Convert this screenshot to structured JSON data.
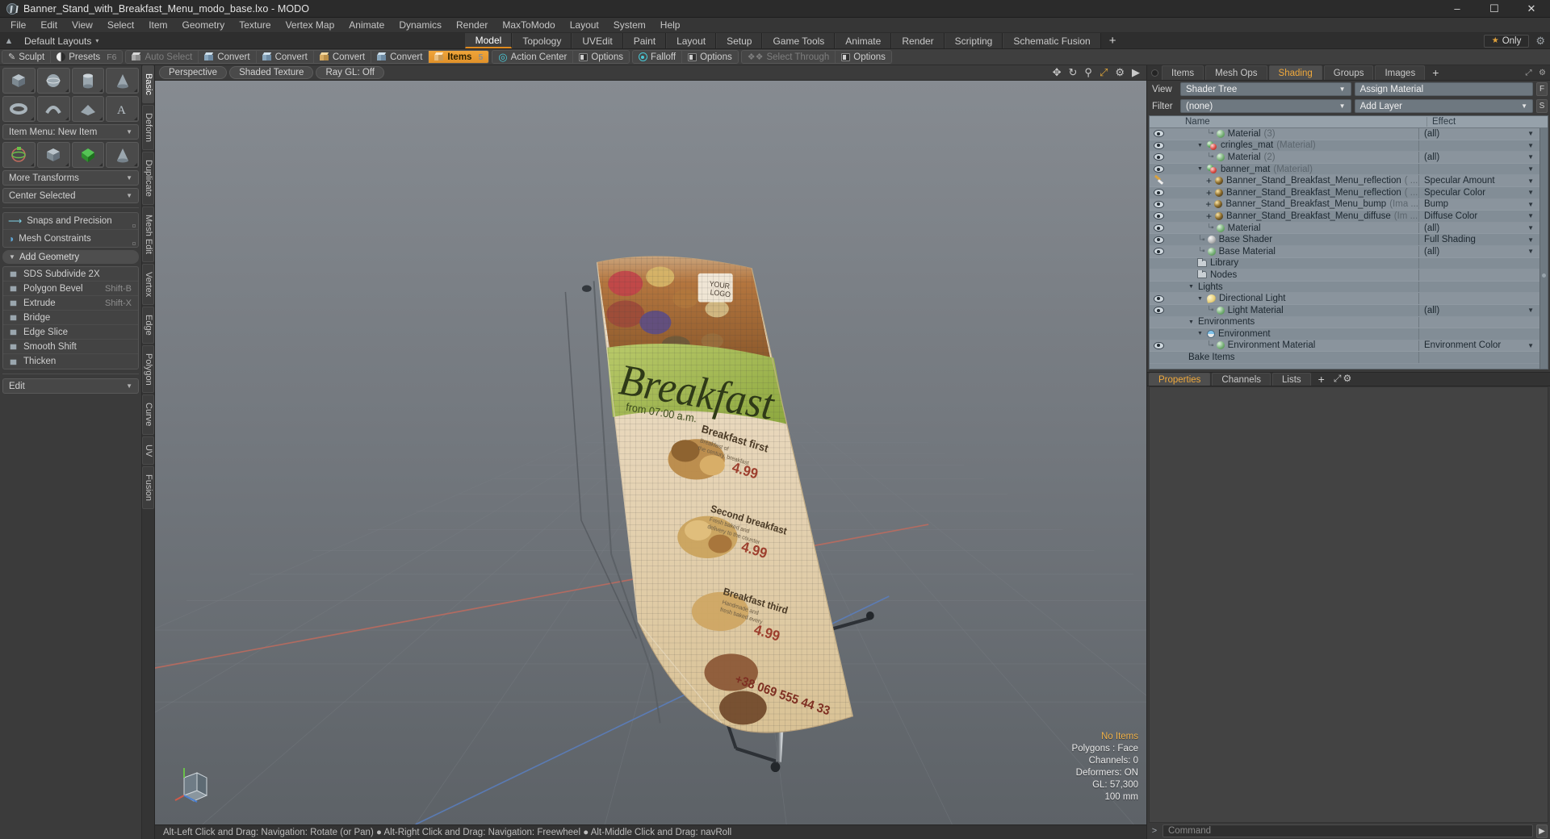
{
  "window": {
    "title": "Banner_Stand_with_Breakfast_Menu_modo_base.lxo - MODO",
    "minimize": "–",
    "maximize": "☐",
    "close": "✕"
  },
  "menubar": {
    "items": [
      "File",
      "Edit",
      "View",
      "Select",
      "Item",
      "Geometry",
      "Texture",
      "Vertex Map",
      "Animate",
      "Dynamics",
      "Render",
      "MaxToModo",
      "Layout",
      "System",
      "Help"
    ]
  },
  "layout_row": {
    "default_layouts": "Default Layouts",
    "caret": "▾",
    "tabs": [
      {
        "label": "Model",
        "active": true
      },
      {
        "label": "Topology",
        "active": false
      },
      {
        "label": "UVEdit",
        "active": false
      },
      {
        "label": "Paint",
        "active": false
      },
      {
        "label": "Layout",
        "active": false
      },
      {
        "label": "Setup",
        "active": false
      },
      {
        "label": "Game Tools",
        "active": false
      },
      {
        "label": "Animate",
        "active": false
      },
      {
        "label": "Render",
        "active": false
      },
      {
        "label": "Scripting",
        "active": false
      },
      {
        "label": "Schematic Fusion",
        "active": false
      }
    ],
    "add_tab": "+",
    "only_button": "Only",
    "only_star": "★"
  },
  "toolstrip": {
    "group1": [
      {
        "label": "Sculpt",
        "icon": "pen-icon",
        "state": "normal",
        "shortcut": ""
      },
      {
        "label": "Presets",
        "icon": "presets-icon",
        "state": "normal",
        "shortcut": "F6"
      }
    ],
    "group2": [
      {
        "label": "Auto Select",
        "icon": "cube-grey-icon",
        "state": "dim",
        "shortcut": ""
      },
      {
        "label": "Convert",
        "icon": "convert-cube-icon",
        "state": "normal",
        "shortcut": ""
      },
      {
        "label": "Convert",
        "icon": "convert-cube-icon",
        "state": "normal",
        "shortcut": ""
      },
      {
        "label": "Convert",
        "icon": "convert-cube-gold-icon",
        "state": "normal",
        "shortcut": ""
      },
      {
        "label": "Convert",
        "icon": "convert-cube-icon",
        "state": "normal",
        "shortcut": ""
      },
      {
        "label": "Items",
        "icon": "items-cube-icon",
        "state": "hot",
        "shortcut": "5"
      }
    ],
    "group3": [
      {
        "label": "Action Center",
        "icon": "action-center-icon",
        "state": "normal",
        "shortcut": ""
      },
      {
        "label": "Options",
        "icon": "options-icon",
        "state": "normal",
        "shortcut": ""
      }
    ],
    "group4": [
      {
        "label": "Falloff",
        "icon": "falloff-icon",
        "state": "normal",
        "shortcut": ""
      },
      {
        "label": "Options",
        "icon": "options-icon",
        "state": "normal",
        "shortcut": ""
      }
    ],
    "group5": [
      {
        "label": "Select Through",
        "icon": "select-through-icon",
        "state": "dim",
        "shortcut": ""
      },
      {
        "label": "Options",
        "icon": "options-icon",
        "state": "normal",
        "shortcut": ""
      }
    ]
  },
  "sidebar": {
    "shape_row_1": [
      "box-icon",
      "sphere-icon",
      "cylinder-icon",
      "cone-icon"
    ],
    "shape_row_2": [
      "torus-icon",
      "tube-icon",
      "plane-icon",
      "text-icon"
    ],
    "item_menu": "Item Menu: New Item",
    "transform_icons": [
      "transform-gizmo-icon",
      "mesh-plane-icon",
      "checker-mesh-icon",
      "cone-mesh-icon"
    ],
    "more_transforms": "More Transforms",
    "center_selected": "Center Selected",
    "snaps": {
      "label": "Snaps and Precision",
      "icon": "snap-arrow-icon"
    },
    "constraints": {
      "label": "Mesh Constraints",
      "icon": "constraint-icon"
    },
    "add_geometry_header": "Add Geometry",
    "geometry_tools": [
      {
        "label": "SDS Subdivide 2X",
        "shortcut": "",
        "icon": "subdivide-icon"
      },
      {
        "label": "Polygon Bevel",
        "shortcut": "Shift-B",
        "icon": "bevel-icon"
      },
      {
        "label": "Extrude",
        "shortcut": "Shift-X",
        "icon": "extrude-icon"
      },
      {
        "label": "Bridge",
        "shortcut": "",
        "icon": "bridge-icon"
      },
      {
        "label": "Edge Slice",
        "shortcut": "",
        "icon": "edge-slice-icon"
      },
      {
        "label": "Smooth Shift",
        "shortcut": "",
        "icon": "smooth-shift-icon"
      },
      {
        "label": "Thicken",
        "shortcut": "",
        "icon": "thicken-icon"
      }
    ],
    "edit_dropdown": "Edit",
    "vertical_tabs": [
      {
        "label": "Basic",
        "active": true
      },
      {
        "label": "Deform",
        "active": false
      },
      {
        "label": "Duplicate",
        "active": false
      },
      {
        "label": "Mesh Edit",
        "active": false
      },
      {
        "label": "Vertex",
        "active": false
      },
      {
        "label": "Edge",
        "active": false
      },
      {
        "label": "Polygon",
        "active": false
      },
      {
        "label": "Curve",
        "active": false
      },
      {
        "label": "UV",
        "active": false
      },
      {
        "label": "Fusion",
        "active": false
      }
    ]
  },
  "viewport": {
    "chips": [
      "Perspective",
      "Shaded Texture",
      "Ray GL: Off"
    ],
    "icons": [
      "move-icon",
      "rotate-icon",
      "zoom-icon",
      "fit-icon",
      "gear-icon",
      "play-arrow-icon"
    ],
    "hud": {
      "items": "No Items",
      "polygons": "Polygons : Face",
      "channels": "Channels: 0",
      "deformers": "Deformers: ON",
      "gl": "GL: 57,300",
      "scale": "100 mm"
    },
    "banner_text": {
      "logo": "YOUR LOGO",
      "title": "Breakfast",
      "subtitle": "from 07:00 a.m.",
      "items": [
        {
          "name": "Breakfast first",
          "desc": "Breakfast of\nthe century, breakfast is delicious",
          "price": "4.99"
        },
        {
          "name": "Second breakfast",
          "desc": "Fresh baked and\ndelivery to the counter",
          "price": "4.99"
        },
        {
          "name": "Breakfast third",
          "desc": "Handmade and\nfresh baked every morning",
          "price": "4.99"
        }
      ],
      "phone": "+38 069 555 44 33"
    }
  },
  "statusbar": {
    "text": "Alt-Left Click and Drag: Navigation: Rotate (or Pan)  ●  Alt-Right Click and Drag: Navigation: Freewheel  ●  Alt-Middle Click and Drag: navRoll"
  },
  "right_panel": {
    "tabs": [
      {
        "label": "Items",
        "active": false
      },
      {
        "label": "Mesh Ops",
        "active": false
      },
      {
        "label": "Shading",
        "active": true
      },
      {
        "label": "Groups",
        "active": false
      },
      {
        "label": "Images",
        "active": false
      },
      {
        "label": "+",
        "active": false
      }
    ],
    "view_label": "View",
    "view_value": "Shader Tree",
    "assign_material": "Assign Material",
    "assign_btn": "F",
    "filter_label": "Filter",
    "filter_value": "(none)",
    "add_layer": "Add Layer",
    "add_layer_btn": "S",
    "columns": {
      "name": "Name",
      "effect": "Effect"
    },
    "tree": [
      {
        "eye": "eye",
        "indent": 4,
        "connector": "end",
        "icon": "sphere-green",
        "name": "Material",
        "count": "(3)",
        "effect": "(all)",
        "caret": true
      },
      {
        "eye": "eye",
        "indent": 3,
        "connector": "tri",
        "icon": "material-dual",
        "name": "cringles_mat",
        "count": "(Material)",
        "effect": "",
        "caret": true
      },
      {
        "eye": "eye",
        "indent": 4,
        "connector": "end",
        "icon": "sphere-green",
        "name": "Material",
        "count": "(2)",
        "effect": "(all)",
        "caret": true
      },
      {
        "eye": "eye",
        "indent": 3,
        "connector": "tri",
        "icon": "material-dual",
        "name": "banner_mat",
        "count": "(Material)",
        "effect": "",
        "caret": true
      },
      {
        "eye": "brush",
        "indent": 4,
        "connector": "plus",
        "icon": "sphere-dark",
        "name": "Banner_Stand_Breakfast_Menu_reflection",
        "count": "( ...",
        "effect": "Specular Amount",
        "caret": true
      },
      {
        "eye": "eye",
        "indent": 4,
        "connector": "plus",
        "icon": "sphere-dark",
        "name": "Banner_Stand_Breakfast_Menu_reflection",
        "count": "( ...",
        "effect": "Specular Color",
        "caret": true
      },
      {
        "eye": "eye",
        "indent": 4,
        "connector": "plus",
        "icon": "sphere-dark",
        "name": "Banner_Stand_Breakfast_Menu_bump",
        "count": "(Ima ...",
        "effect": "Bump",
        "caret": true
      },
      {
        "eye": "eye",
        "indent": 4,
        "connector": "plus",
        "icon": "sphere-dark",
        "name": "Banner_Stand_Breakfast_Menu_diffuse",
        "count": "(Im ...",
        "effect": "Diffuse Color",
        "caret": true
      },
      {
        "eye": "eye",
        "indent": 4,
        "connector": "end",
        "icon": "sphere-green",
        "name": "Material",
        "count": "",
        "effect": "(all)",
        "caret": true
      },
      {
        "eye": "eye",
        "indent": 3,
        "connector": "end",
        "icon": "sphere-grey",
        "name": "Base Shader",
        "count": "",
        "effect": "Full Shading",
        "caret": true
      },
      {
        "eye": "eye",
        "indent": 3,
        "connector": "end",
        "icon": "sphere-green",
        "name": "Base Material",
        "count": "",
        "effect": "(all)",
        "caret": true
      },
      {
        "eye": "none",
        "indent": 3,
        "connector": "none",
        "icon": "folder",
        "name": "Library",
        "count": "",
        "effect": "",
        "caret": false
      },
      {
        "eye": "none",
        "indent": 3,
        "connector": "none",
        "icon": "folder",
        "name": "Nodes",
        "count": "",
        "effect": "",
        "caret": false
      },
      {
        "eye": "none",
        "indent": 2,
        "connector": "tri-open",
        "icon": "none",
        "name": "Lights",
        "count": "",
        "effect": "",
        "caret": false
      },
      {
        "eye": "eye",
        "indent": 3,
        "connector": "tri",
        "icon": "lamp",
        "name": "Directional Light",
        "count": "",
        "effect": "",
        "caret": false
      },
      {
        "eye": "eye",
        "indent": 4,
        "connector": "end",
        "icon": "sphere-green",
        "name": "Light Material",
        "count": "",
        "effect": "(all)",
        "caret": true
      },
      {
        "eye": "none",
        "indent": 2,
        "connector": "tri-open",
        "icon": "none",
        "name": "Environments",
        "count": "",
        "effect": "",
        "caret": false
      },
      {
        "eye": "none",
        "indent": 3,
        "connector": "tri",
        "icon": "env",
        "name": "Environment",
        "count": "",
        "effect": "",
        "caret": false
      },
      {
        "eye": "eye",
        "indent": 4,
        "connector": "end",
        "icon": "sphere-green",
        "name": "Environment Material",
        "count": "",
        "effect": "Environment Color",
        "caret": true
      },
      {
        "eye": "none",
        "indent": 2,
        "connector": "none",
        "icon": "none",
        "name": "Bake Items",
        "count": "",
        "effect": "",
        "caret": false
      }
    ],
    "bottom_tabs": [
      {
        "label": "Properties",
        "active": true
      },
      {
        "label": "Channels",
        "active": false
      },
      {
        "label": "Lists",
        "active": false
      },
      {
        "label": "+",
        "active": false
      }
    ],
    "command_placeholder": "Command",
    "command_value": ""
  },
  "colors": {
    "accent_orange": "#e8a23c",
    "panel_bg": "#3a3a3a",
    "tree_bg": "#828d96",
    "viewport_grey": "#70757b"
  }
}
